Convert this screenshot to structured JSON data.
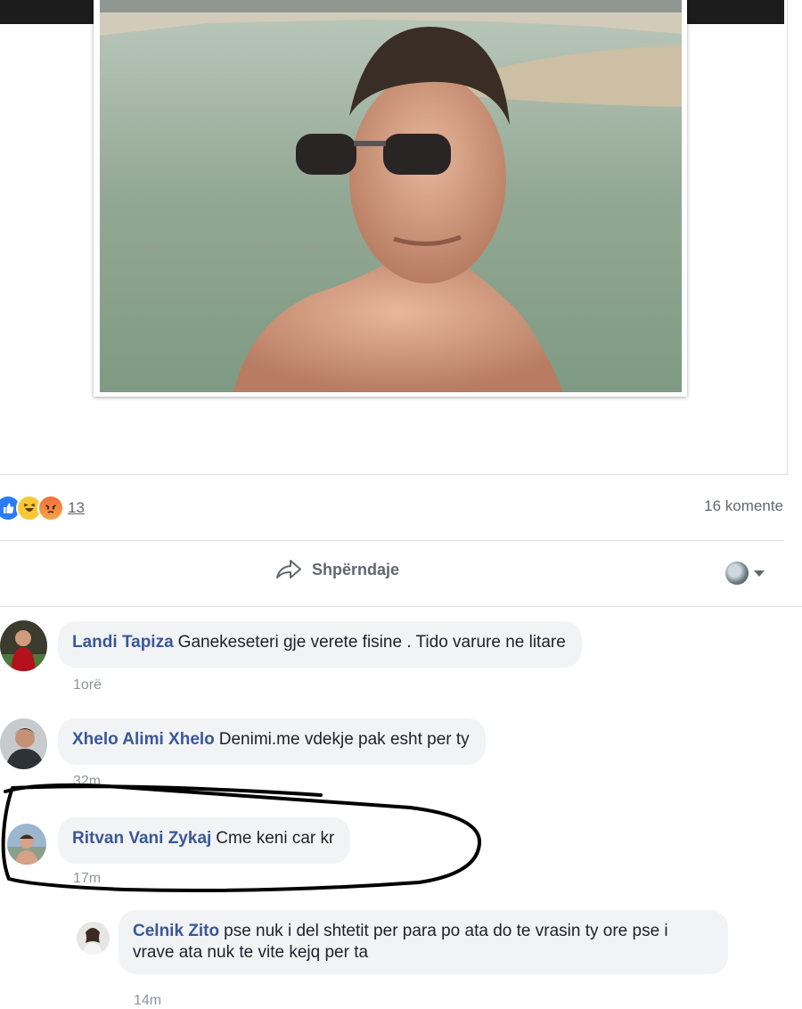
{
  "post": {
    "reaction_count": "13",
    "comments_count": "16 komente",
    "share_label": "Shpërndaje",
    "reaction_icons": [
      "like-icon",
      "haha-icon",
      "angry-icon"
    ]
  },
  "comments": [
    {
      "author": "Landi Tapiza",
      "text": "Ganekeseteri gje verete fisine . Tido varure ne litare",
      "time": "1orë"
    },
    {
      "author": "Xhelo Alimi Xhelo",
      "text": "Denimi.me vdekje pak esht per ty",
      "time": "32m"
    },
    {
      "author": "Ritvan Vani Zykaj",
      "text": "Cme keni car kr",
      "time": "17m"
    },
    {
      "author": "Celnik Zito",
      "text": "pse nuk i del shtetit per para po ata do te vrasin ty ore pse i vrave ata nuk te vite kejq per ta",
      "time": "14m"
    }
  ],
  "colors": {
    "link": "#385898",
    "like": "#2b7bf3",
    "bubble": "#f2f3f5",
    "meta": "#90949c"
  }
}
